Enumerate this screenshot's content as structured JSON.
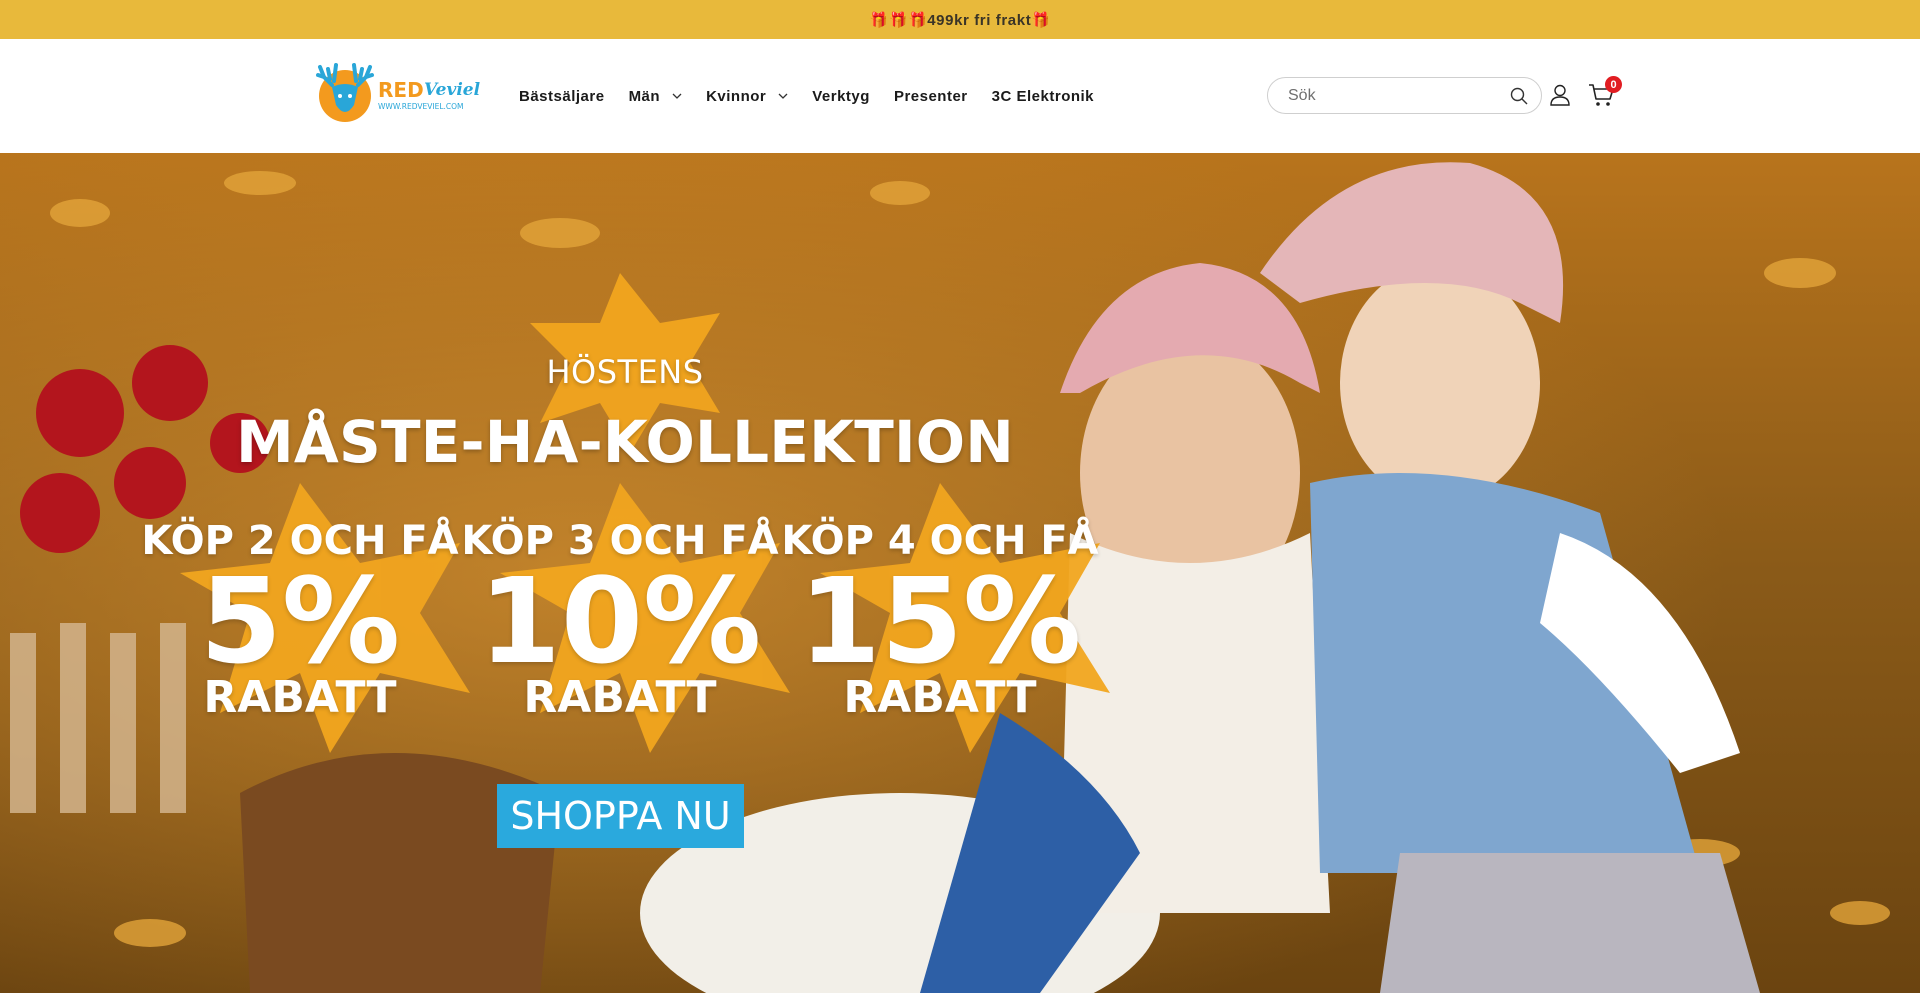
{
  "announcement": {
    "text": "🎁🎁🎁499kr fri frakt🎁"
  },
  "brand": {
    "name_red": "RED",
    "name_script": "Veviel",
    "url": "WWW.REDVEVIEL.COM",
    "colors": {
      "orange": "#f39a1e",
      "blue": "#29a6d8",
      "red": "#e11d22"
    }
  },
  "nav": {
    "items": [
      {
        "label": "Bästsäljare",
        "has_dropdown": false
      },
      {
        "label": "Män",
        "has_dropdown": true
      },
      {
        "label": "Kvinnor",
        "has_dropdown": true
      },
      {
        "label": "Verktyg",
        "has_dropdown": false
      },
      {
        "label": "Presenter",
        "has_dropdown": false
      },
      {
        "label": "3C Elektronik",
        "has_dropdown": false
      }
    ]
  },
  "search": {
    "placeholder": "Sök",
    "icon": "search-icon"
  },
  "account": {
    "icon": "user-icon"
  },
  "cart": {
    "icon": "cart-icon",
    "count": "0"
  },
  "hero": {
    "subtitle": "HÖSTENS",
    "title": "MÅSTE-HA-KOLLEKTION",
    "offers": [
      {
        "line": "KÖP 2 OCH FÅ",
        "percent": "5%",
        "label": "RABATT"
      },
      {
        "line": "KÖP 3 OCH FÅ",
        "percent": "10%",
        "label": "RABATT"
      },
      {
        "line": "KÖP 4 OCH FÅ",
        "percent": "15%",
        "label": "RABATT"
      }
    ],
    "cta": "SHOPPA NU"
  }
}
